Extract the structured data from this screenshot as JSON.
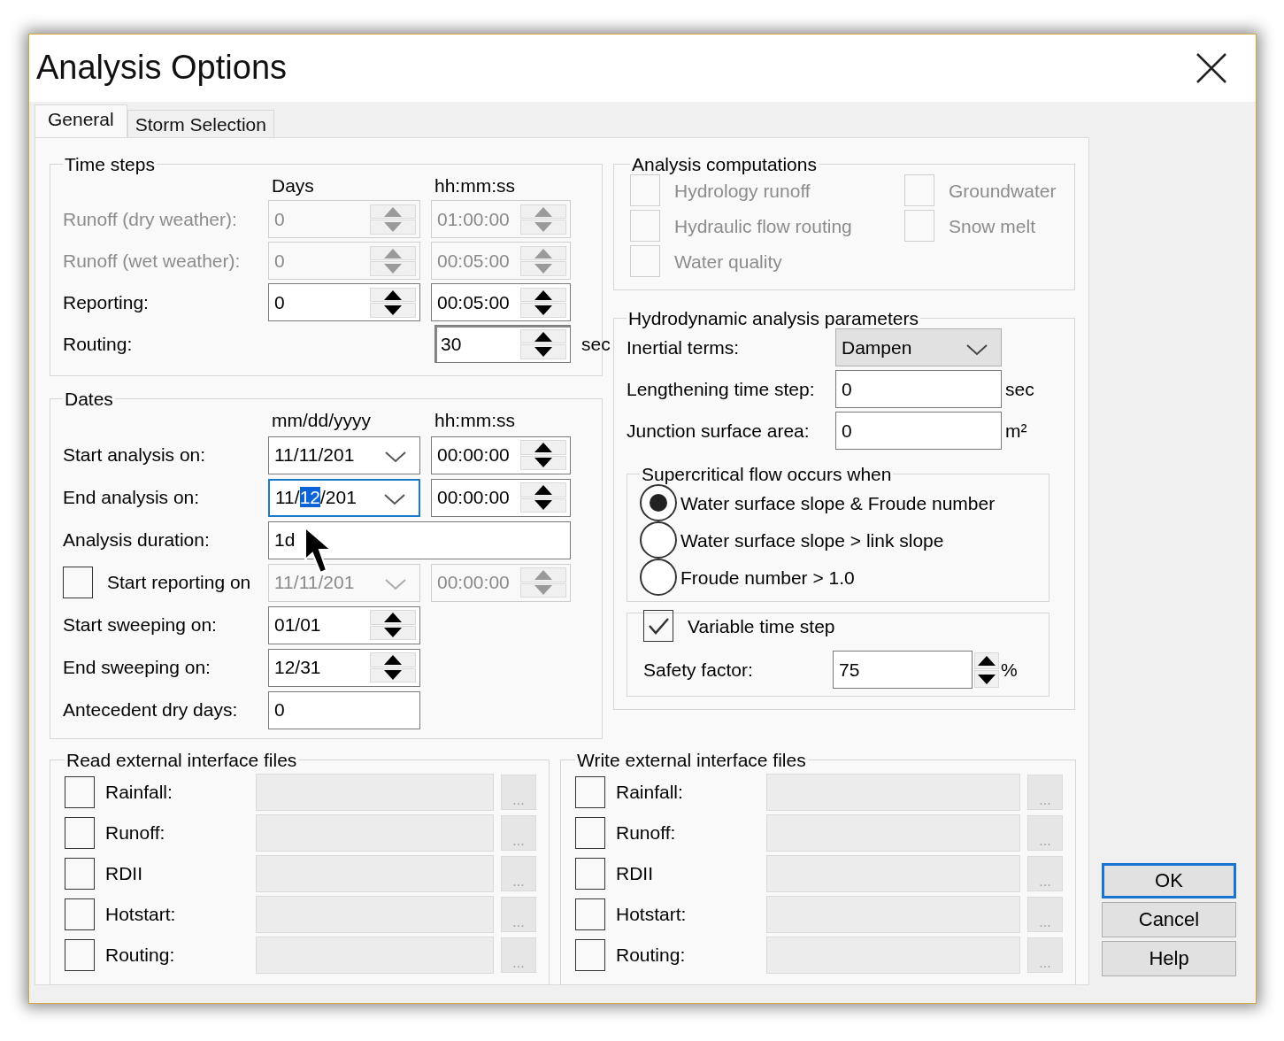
{
  "window": {
    "title": "Analysis Options"
  },
  "tabs": [
    {
      "label": "General",
      "selected": true
    },
    {
      "label": "Storm Selection",
      "selected": false
    }
  ],
  "time_steps": {
    "title": "Time steps",
    "column_headers": [
      "Days",
      "hh:mm:ss"
    ],
    "rows": [
      {
        "label": "Runoff (dry weather):",
        "disabled": true,
        "days": "0",
        "time": "01:00:00"
      },
      {
        "label": "Runoff (wet weather):",
        "disabled": true,
        "days": "0",
        "time": "00:05:00"
      },
      {
        "label": "Reporting:",
        "disabled": false,
        "days": "0",
        "time": "00:05:00"
      },
      {
        "label": "Routing:",
        "disabled": false,
        "time": "30",
        "unit": "sec"
      }
    ]
  },
  "dates": {
    "title": "Dates",
    "column_headers": [
      "mm/dd/yyyy",
      "hh:mm:ss"
    ],
    "rows": [
      {
        "kind": "date",
        "label": "Start analysis on:",
        "disabled": false,
        "focused": false,
        "date": [
          {
            "text": "11/11/201",
            "selected": false
          }
        ],
        "time": "00:00:00"
      },
      {
        "kind": "date",
        "label": "End analysis on:",
        "disabled": false,
        "focused": true,
        "date": [
          {
            "text": "11/",
            "selected": false
          },
          {
            "text": "12",
            "selected": true
          },
          {
            "text": "/201",
            "selected": false
          }
        ],
        "time": "00:00:00"
      },
      {
        "kind": "wide_text",
        "label": "Analysis duration:",
        "value": "1d"
      },
      {
        "kind": "check_date",
        "label": "Start reporting on",
        "checked": false,
        "disabled": true,
        "focused": false,
        "date": [
          {
            "text": "11/11/201",
            "selected": false
          }
        ],
        "time": "00:00:00"
      },
      {
        "kind": "spin",
        "label": "Start sweeping on:",
        "value": "01/01"
      },
      {
        "kind": "spin",
        "label": "End sweeping on:",
        "value": "12/31"
      },
      {
        "kind": "text",
        "label": "Antecedent dry days:",
        "value": "0"
      }
    ]
  },
  "analysis_computations": {
    "title": "Analysis computations",
    "items": [
      {
        "label": "Hydrology runoff",
        "checked": false,
        "disabled": true
      },
      {
        "label": "Groundwater",
        "checked": false,
        "disabled": true
      },
      {
        "label": "Hydraulic flow routing",
        "checked": false,
        "disabled": true
      },
      {
        "label": "Snow melt",
        "checked": false,
        "disabled": true
      },
      {
        "label": "Water quality",
        "checked": false,
        "disabled": true
      }
    ]
  },
  "hydrodynamic": {
    "title": "Hydrodynamic analysis parameters",
    "inertial_terms": {
      "label": "Inertial terms:",
      "value": "Dampen"
    },
    "lengthening_time_step": {
      "label": "Lengthening time step:",
      "value": "0",
      "unit": "sec"
    },
    "junction_surface_area": {
      "label": "Junction surface area:",
      "value": "0",
      "unit": "m²"
    },
    "supercritical": {
      "title": "Supercritical flow occurs when",
      "options": [
        {
          "label": "Water surface slope & Froude number",
          "selected": true
        },
        {
          "label": "Water surface slope > link slope",
          "selected": false
        },
        {
          "label": "Froude number > 1.0",
          "selected": false
        }
      ]
    },
    "variable_time_step": {
      "label": "Variable time step",
      "checked": true
    },
    "safety_factor": {
      "label": "Safety factor:",
      "value": "75",
      "unit": "%"
    }
  },
  "read_files": {
    "title": "Read external interface files",
    "rows": [
      {
        "label": "Rainfall:",
        "checked": false,
        "disabled": true,
        "browse": "..."
      },
      {
        "label": "Runoff:",
        "checked": false,
        "disabled": true,
        "browse": "..."
      },
      {
        "label": "RDII",
        "checked": false,
        "disabled": true,
        "browse": "..."
      },
      {
        "label": "Hotstart:",
        "checked": false,
        "disabled": true,
        "browse": "..."
      },
      {
        "label": "Routing:",
        "checked": false,
        "disabled": true,
        "browse": "..."
      }
    ]
  },
  "write_files": {
    "title": "Write external interface files",
    "rows": [
      {
        "label": "Rainfall:",
        "checked": false,
        "disabled": true,
        "browse": "..."
      },
      {
        "label": "Runoff:",
        "checked": false,
        "disabled": true,
        "browse": "..."
      },
      {
        "label": "RDII",
        "checked": false,
        "disabled": true,
        "browse": "..."
      },
      {
        "label": "Hotstart:",
        "checked": false,
        "disabled": true,
        "browse": "..."
      },
      {
        "label": "Routing:",
        "checked": false,
        "disabled": true,
        "browse": "..."
      }
    ]
  },
  "buttons": [
    {
      "label": "OK",
      "default": true
    },
    {
      "label": "Cancel",
      "default": false
    },
    {
      "label": "Help",
      "default": false
    }
  ]
}
